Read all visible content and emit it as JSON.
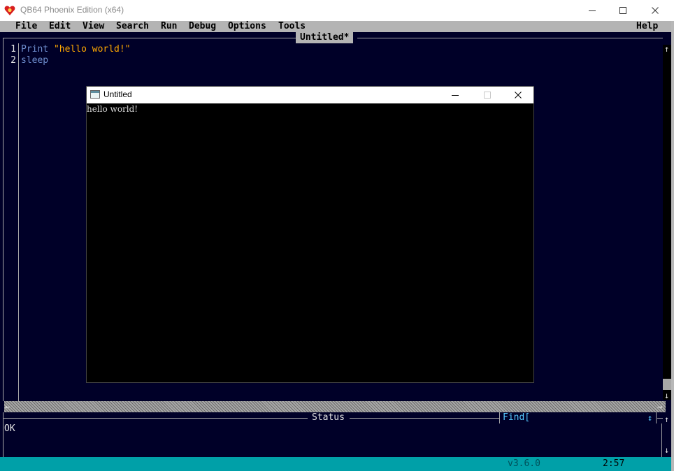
{
  "window": {
    "title": "QB64 Phoenix Edition (x64)",
    "icon": "qb64-heart-icon",
    "controls": [
      "minimize-icon",
      "maximize-icon",
      "close-icon"
    ]
  },
  "menu": {
    "items": [
      "File",
      "Edit",
      "View",
      "Search",
      "Run",
      "Debug",
      "Options",
      "Tools"
    ],
    "help": "Help"
  },
  "editor": {
    "tab_title": "Untitled*",
    "lines": [
      {
        "number": "1",
        "keyword": "Print",
        "string": "\"hello world!\""
      },
      {
        "number": "2",
        "keyword": "sleep",
        "string": ""
      }
    ]
  },
  "program_window": {
    "title": "Untitled",
    "output": "hello world!"
  },
  "status": {
    "label": "Status",
    "text": "OK",
    "find_label": "Find["
  },
  "footer": {
    "version": "v3.6.0",
    "clock": "2:57"
  },
  "colors": {
    "editor_bg": "#000028",
    "menu_bg": "#b4b4b4",
    "keyword": "#6f8fd0",
    "string": "#ffa800",
    "footer_bg": "#00a0a8"
  }
}
